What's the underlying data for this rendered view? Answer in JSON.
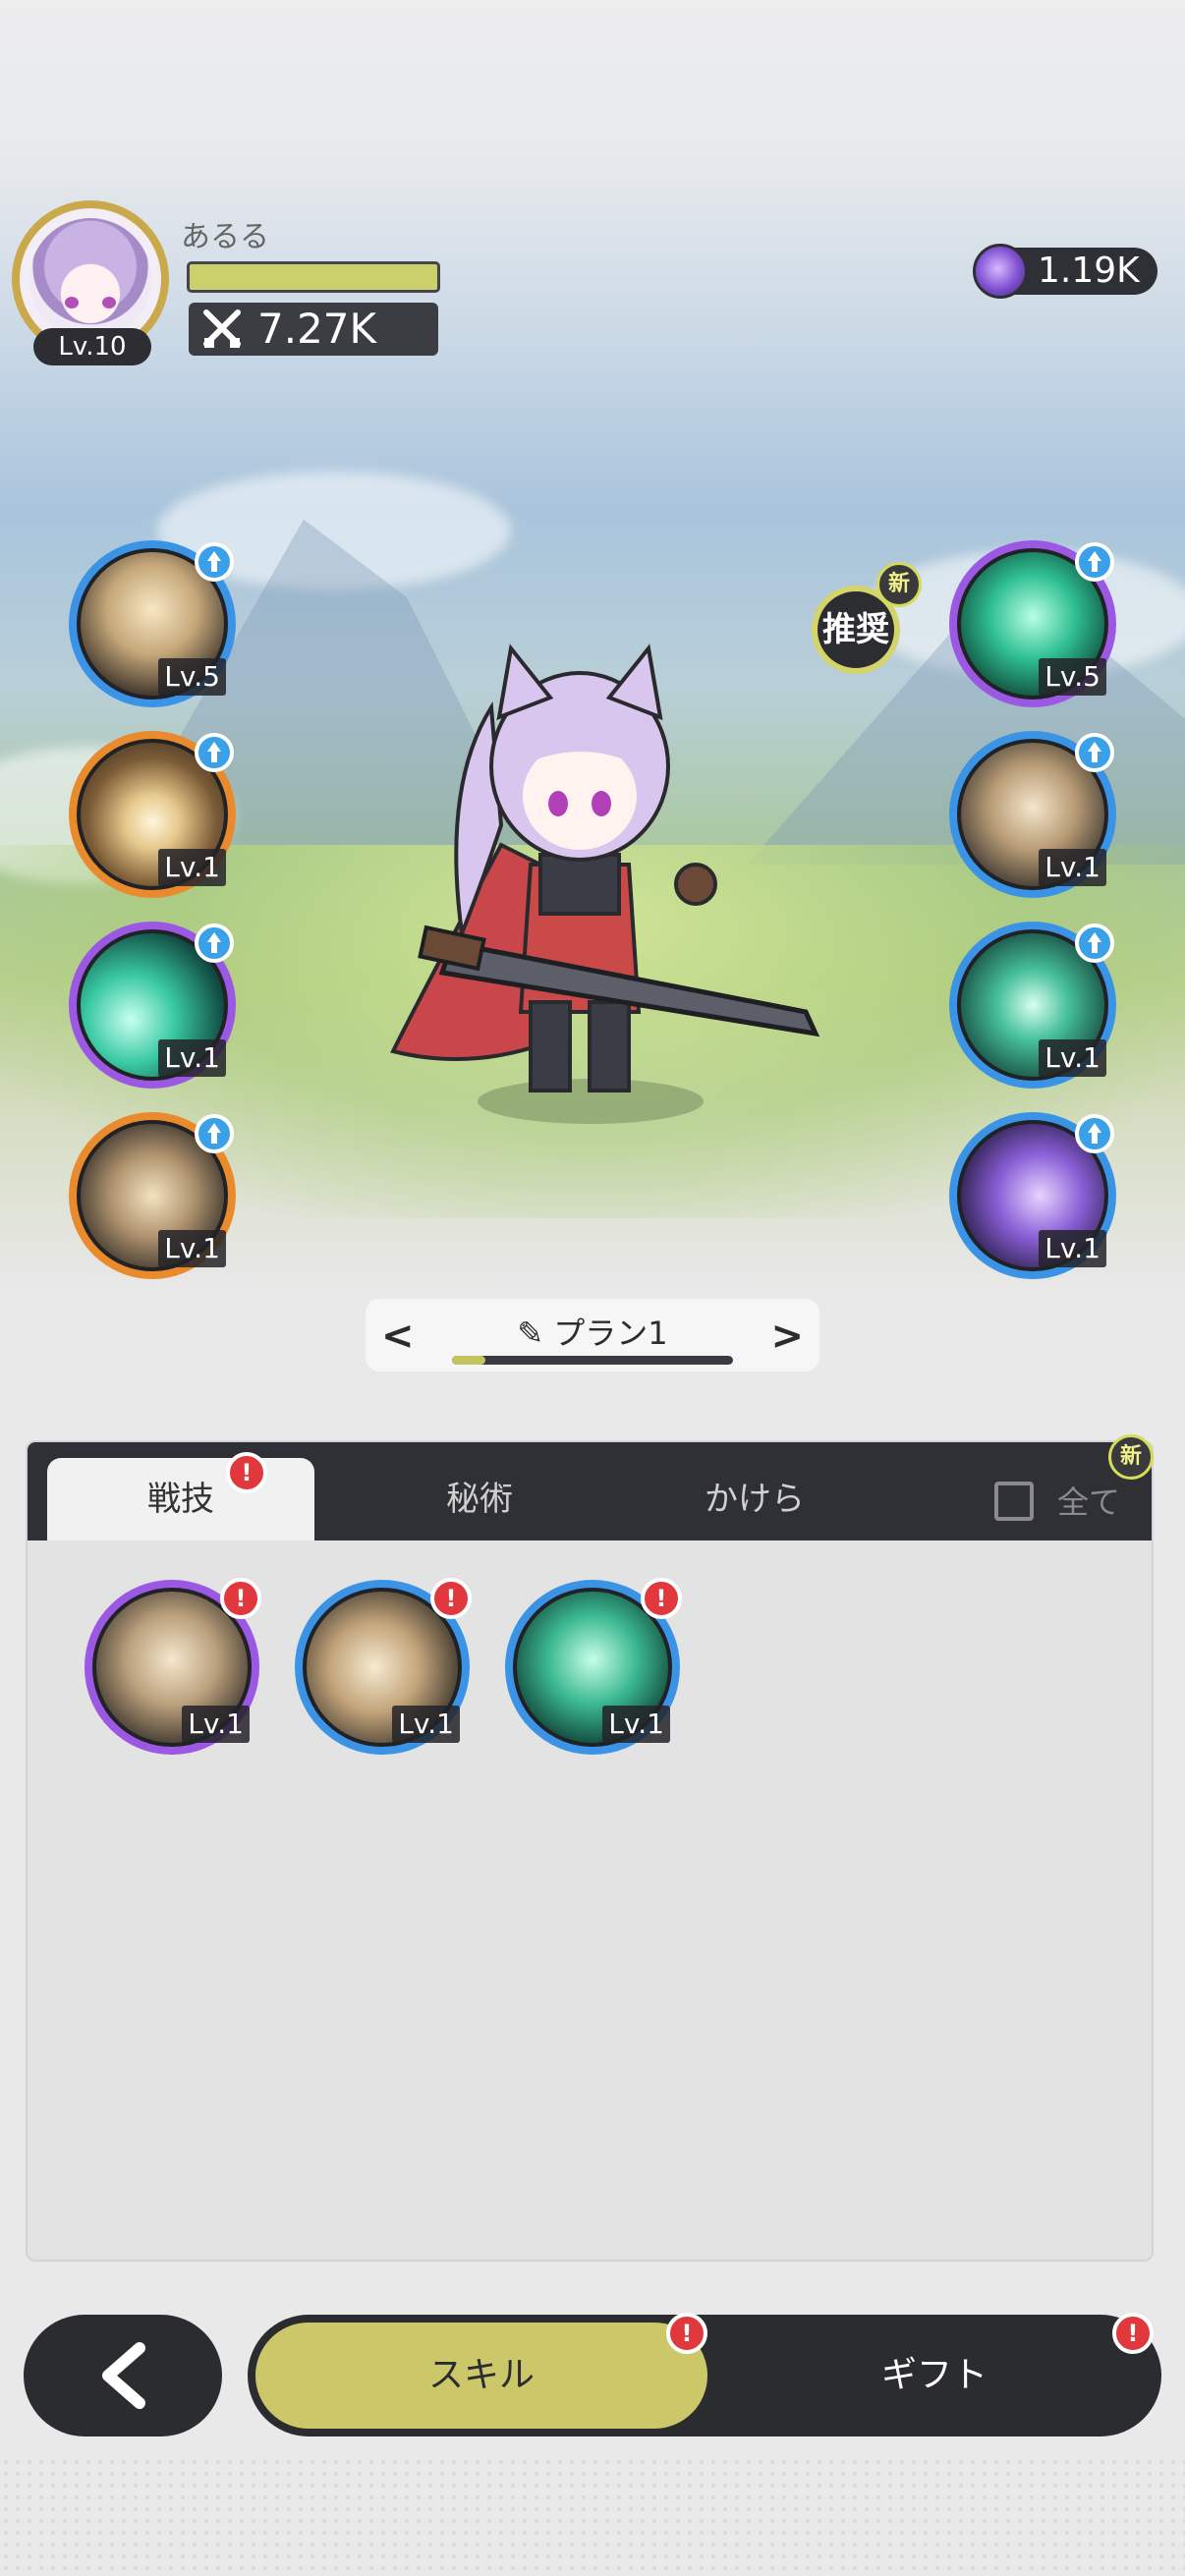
{
  "header": {
    "player_name": "あるる",
    "level": "Lv.10",
    "power": "7.27K",
    "currency": "1.19K"
  },
  "skill_slots_left": [
    {
      "level": "Lv.5",
      "icon": "burst-strike-icon",
      "ring": "blue"
    },
    {
      "level": "Lv.1",
      "icon": "explosion-icon",
      "ring": "orange"
    },
    {
      "level": "Lv.1",
      "icon": "green-slash-icon",
      "ring": "purple"
    },
    {
      "level": "Lv.1",
      "icon": "whirlwind-icon",
      "ring": "orange"
    }
  ],
  "skill_slots_right": [
    {
      "level": "Lv.5",
      "icon": "emerald-sword-icon",
      "ring": "purple"
    },
    {
      "level": "Lv.1",
      "icon": "sword-up-icon",
      "ring": "blue"
    },
    {
      "level": "Lv.1",
      "icon": "heal-heart-icon",
      "ring": "blue"
    },
    {
      "level": "Lv.1",
      "icon": "shadow-dash-icon",
      "ring": "blue"
    }
  ],
  "recommend": {
    "label": "推奨",
    "new_badge": "新"
  },
  "plan": {
    "label": "プラン1",
    "progress": 0.12
  },
  "panel": {
    "tabs": [
      "戦技",
      "秘術",
      "かけら"
    ],
    "active_tab": 0,
    "tab_alert": "!",
    "check_all_label": "全て",
    "new_badge": "新",
    "skills": [
      {
        "level": "Lv.1",
        "icon": "shatter-strike-icon",
        "ring": "purple",
        "alert": "!"
      },
      {
        "level": "Lv.1",
        "icon": "crescent-slash-icon",
        "ring": "blue",
        "alert": "!"
      },
      {
        "level": "Lv.1",
        "icon": "spirit-sword-icon",
        "ring": "blue",
        "alert": "!"
      }
    ]
  },
  "bottom": {
    "skill_label": "スキル",
    "gift_label": "ギフト",
    "alert": "!"
  },
  "colors": {
    "accent_yellow": "#ccc86a",
    "dark": "#2b2c30",
    "alert_red": "#e0383d",
    "ring_blue": "#3b93e6",
    "ring_orange": "#e98a2d",
    "ring_purple": "#9b58e2"
  }
}
